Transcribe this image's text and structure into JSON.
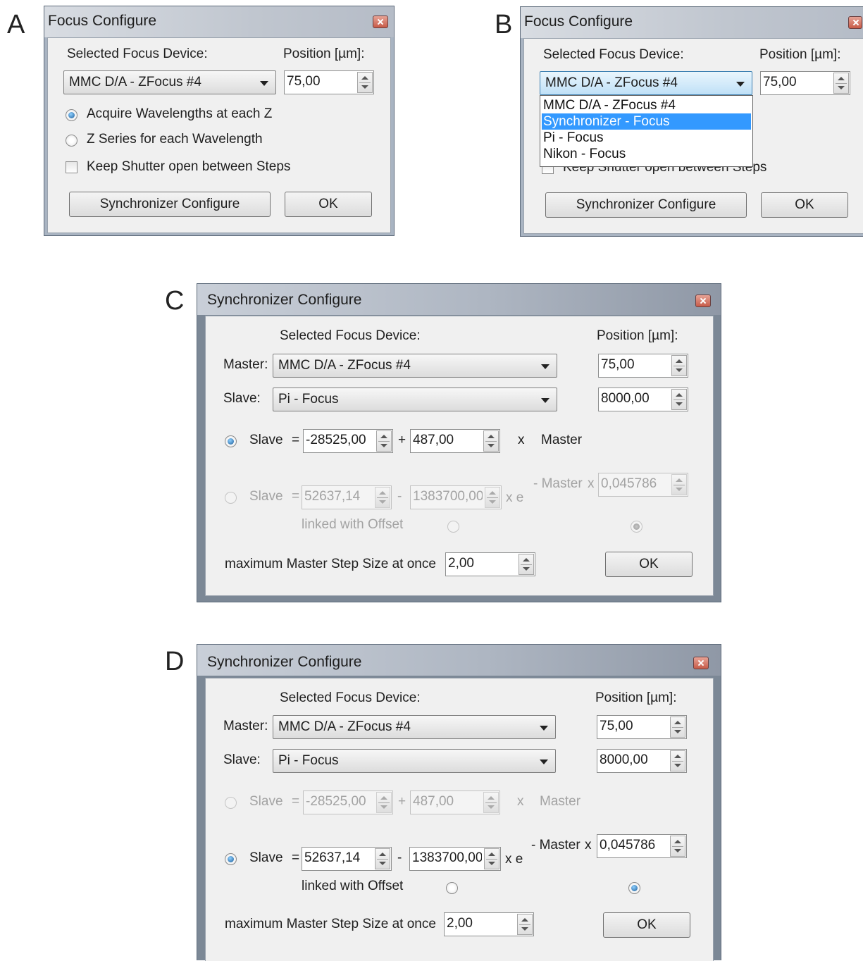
{
  "panel_labels": {
    "a": "A",
    "b": "B",
    "c": "C",
    "d": "D"
  },
  "focus_configure": {
    "title": "Focus Configure",
    "selected_device_label": "Selected Focus Device:",
    "position_label": "Position [µm]:",
    "device_value": "MMC D/A - ZFocus #4",
    "position_value": "75,00",
    "radio_acquire": "Acquire Wavelengths at each Z",
    "radio_zseries": "Z Series for each Wavelength",
    "checkbox_keep_shutter": "Keep Shutter open between Steps",
    "sync_button": "Synchronizer Configure",
    "ok_button": "OK",
    "dropdown_options": [
      "MMC D/A - ZFocus #4",
      "Synchronizer - Focus",
      "Pi - Focus",
      "Nikon - Focus"
    ],
    "dropdown_selected": "Synchronizer - Focus"
  },
  "synchronizer_configure": {
    "title": "Synchronizer Configure",
    "selected_device_label": "Selected Focus Device:",
    "position_label": "Position [µm]:",
    "master_label": "Master:",
    "slave_label": "Slave:",
    "master_device": "MMC D/A - ZFocus #4",
    "slave_device": "Pi - Focus",
    "master_position": "75,00",
    "slave_position": "8000,00",
    "linear": {
      "slave": "Slave",
      "equals": "=",
      "offset": "-28525,00",
      "plus": "+",
      "factor": "487,00",
      "times": "x",
      "master": "Master"
    },
    "exponential": {
      "slave": "Slave",
      "equals": "=",
      "a": "52637,14",
      "minus": "-",
      "b": "1383700,00",
      "xe": "x e",
      "exp_label": "- Master",
      "x": "x",
      "k": "0,045786"
    },
    "linked_label": "linked with Offset",
    "max_step_label": "maximum Master Step Size at once",
    "max_step_value": "2,00",
    "ok_button": "OK"
  }
}
